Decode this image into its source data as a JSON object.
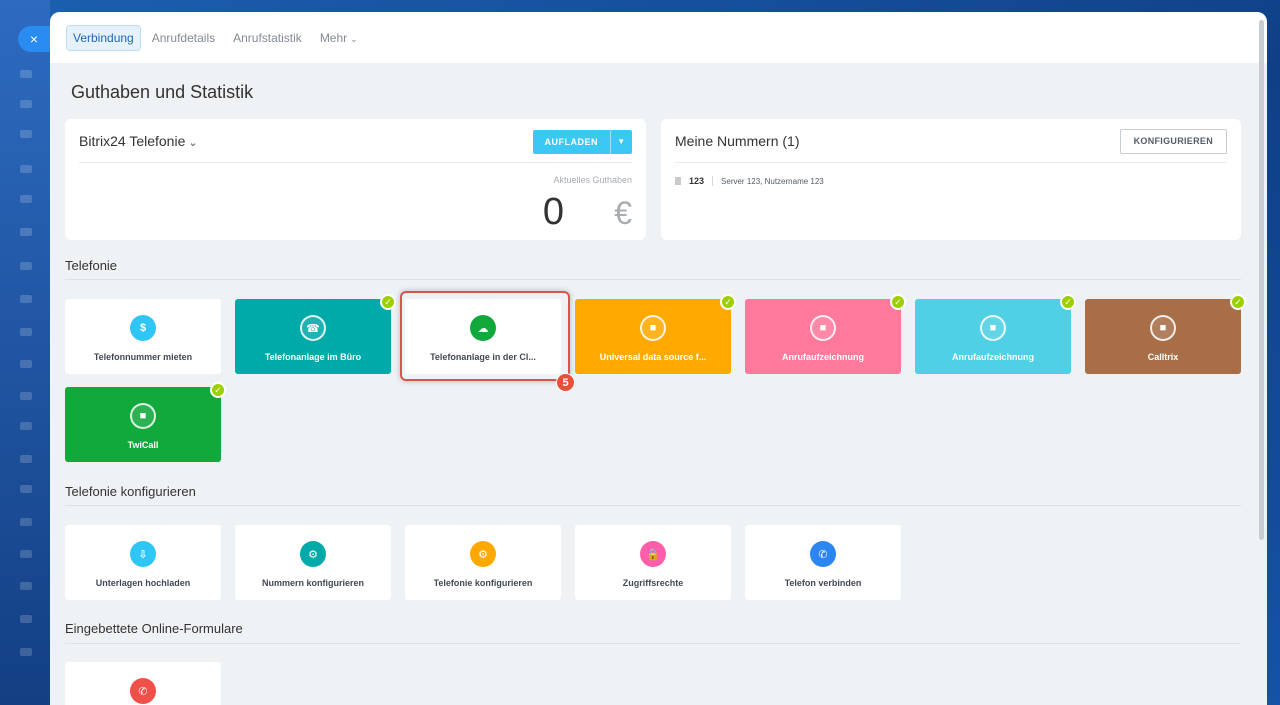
{
  "close_icon": "×",
  "tabs": [
    {
      "label": "Verbindung"
    },
    {
      "label": "Anrufdetails"
    },
    {
      "label": "Anrufstatistik"
    },
    {
      "label": "Mehr"
    }
  ],
  "page_title": "Guthaben und Statistik",
  "balance_card": {
    "title": "Bitrix24 Telefonie",
    "button": "AUFLADEN",
    "balance_label": "Aktuelles Guthaben",
    "balance_value": "0",
    "currency": "€"
  },
  "numbers_card": {
    "title": "Meine Nummern (1)",
    "button": "KONFIGURIEREN",
    "number": "123",
    "details": "Server 123, Nutzername 123"
  },
  "sections": {
    "telefonie": "Telefonie",
    "konfigurieren": "Telefonie konfigurieren",
    "formulare": "Eingebettete Online-Formulare"
  },
  "telefonie_tiles": [
    {
      "label": "Telefonnummer mieten",
      "color": "#ffffff",
      "icon": "phone-dollar-icon",
      "checked": false
    },
    {
      "label": "Telefonanlage im Büro",
      "color": "#00aaa8",
      "icon": "office-pbx-icon",
      "checked": true
    },
    {
      "label": "Telefonanlage in der Cl...",
      "color": "#ffffff",
      "icon": "cloud-pbx-icon",
      "checked": false
    },
    {
      "label": "Universal data source f...",
      "color": "#ffa900",
      "icon": "box-icon",
      "checked": true
    },
    {
      "label": "Anrufaufzeichnung",
      "color": "#ff799c",
      "icon": "box-icon",
      "checked": true
    },
    {
      "label": "Anrufaufzeichnung",
      "color": "#4fd0e4",
      "icon": "box-icon",
      "checked": true
    },
    {
      "label": "Calltrix",
      "color": "#a86e48",
      "icon": "box-icon",
      "checked": true
    },
    {
      "label": "TwiCall",
      "color": "#11a83c",
      "icon": "box-icon",
      "checked": true
    }
  ],
  "config_tiles": [
    {
      "label": "Unterlagen hochladen",
      "color": "#2fc6f6",
      "icon": "upload-document-icon"
    },
    {
      "label": "Nummern konfigurieren",
      "color": "#00aaa8",
      "icon": "phone-gear-icon"
    },
    {
      "label": "Telefonie konfigurieren",
      "color": "#ffa900",
      "icon": "settings-gear-icon"
    },
    {
      "label": "Zugriffsrechte",
      "color": "#ff5eaa",
      "icon": "user-lock-icon"
    },
    {
      "label": "Telefon verbinden",
      "color": "#2b86f0",
      "icon": "phone-connect-icon"
    }
  ],
  "forms_tiles": [
    {
      "label": "",
      "color": "#f0504a",
      "icon": "phone-callback-icon"
    }
  ],
  "step_badge": "5"
}
